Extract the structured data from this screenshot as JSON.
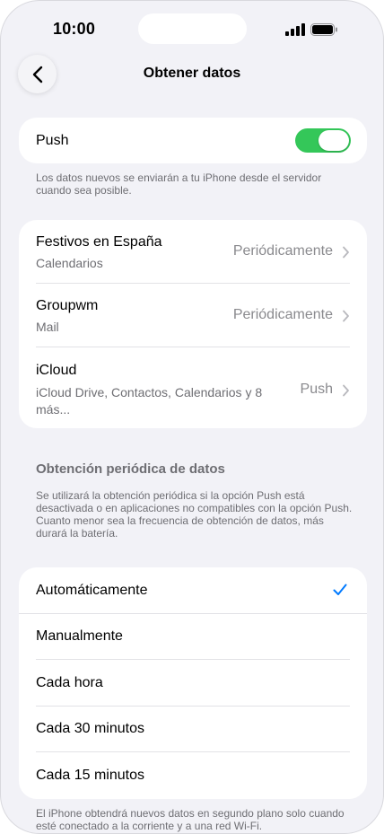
{
  "status": {
    "time": "10:00"
  },
  "nav": {
    "title": "Obtener datos"
  },
  "push": {
    "label": "Push",
    "enabled": true,
    "note": "Los datos nuevos se enviarán a tu iPhone desde el servidor cuando sea posible."
  },
  "accounts": [
    {
      "name": "Festivos en España",
      "detail": "Calendarios",
      "value": "Periódicamente"
    },
    {
      "name": "Groupwm",
      "detail": "Mail",
      "value": "Periódicamente"
    },
    {
      "name": "iCloud",
      "detail": "iCloud Drive, Contactos, Calendarios y 8 más...",
      "value": "Push"
    }
  ],
  "fetch": {
    "header": "Obtención periódica de datos",
    "note": "Se utilizará la obtención periódica si la opción Push está desactivada o en aplicaciones no compatibles con la opción Push. Cuanto menor sea la frecuencia de obtención de datos, más durará la batería.",
    "options": [
      "Automáticamente",
      "Manualmente",
      "Cada hora",
      "Cada 30 minutos",
      "Cada 15 minutos"
    ],
    "selected": "Automáticamente",
    "footer": "El iPhone obtendrá nuevos datos en segundo plano solo cuando esté conectado a la corriente y a una red Wi-Fi."
  },
  "colors": {
    "accent": "#007aff",
    "toggle_on": "#34c759"
  }
}
